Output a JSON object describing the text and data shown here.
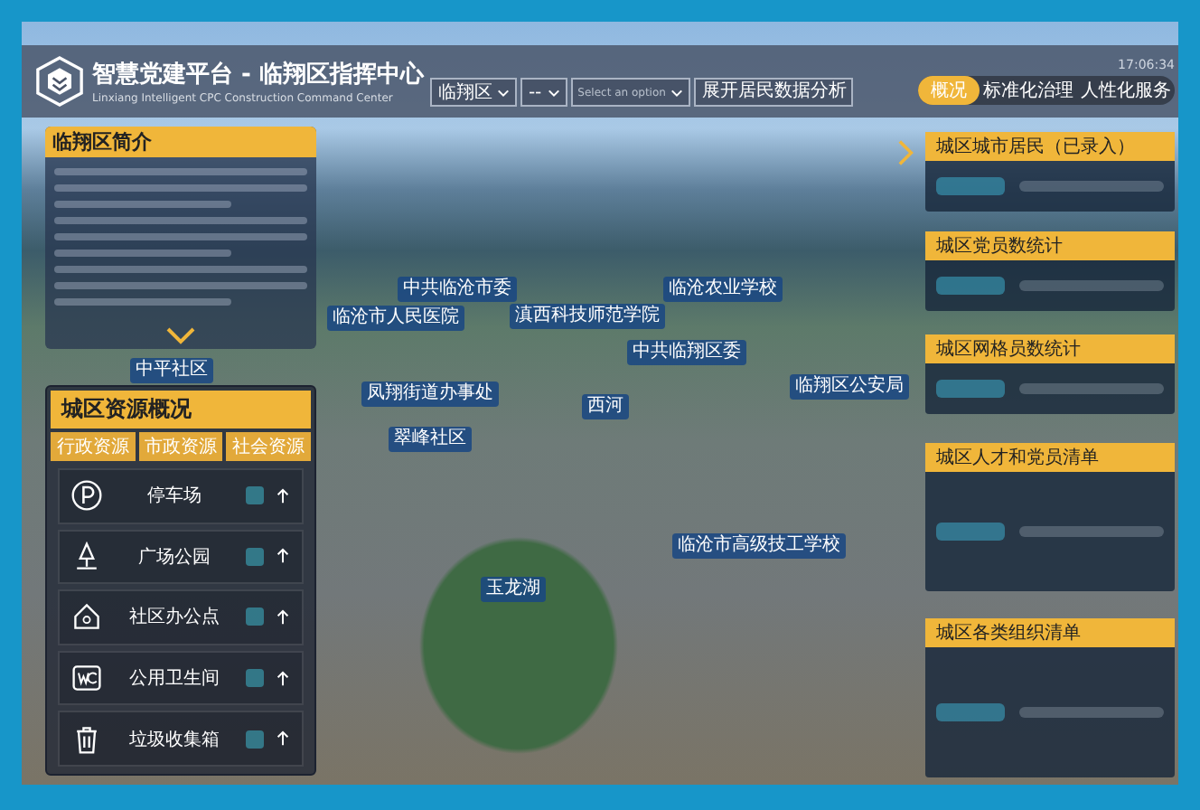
{
  "header": {
    "title": "智慧党建平台 - 临翔区指挥中心",
    "subtitle": "Linxiang Intelligent CPC Construction Command Center",
    "selects": [
      {
        "value": "临翔区"
      },
      {
        "value": "--"
      },
      {
        "placeholder": "Select an option"
      }
    ],
    "button": "展开居民数据分析",
    "time": "17:06:34",
    "tabs": [
      {
        "label": "概况",
        "selected": true
      },
      {
        "label": "标准化治理",
        "selected": false
      },
      {
        "label": "人性化服务",
        "selected": false
      }
    ]
  },
  "intro": {
    "title": "临翔区简介"
  },
  "resources": {
    "title": "城区资源概况",
    "tabs": [
      {
        "label": "行政资源",
        "selected": false
      },
      {
        "label": "市政资源",
        "selected": false
      },
      {
        "label": "社会资源",
        "selected": false
      }
    ],
    "items": [
      {
        "kind": "parking",
        "label": "停车场"
      },
      {
        "kind": "park",
        "label": "广场公园"
      },
      {
        "kind": "office",
        "label": "社区办公点"
      },
      {
        "kind": "toilet",
        "label": "公用卫生间"
      },
      {
        "kind": "trash",
        "label": "垃圾收集箱"
      }
    ]
  },
  "map": {
    "pins": [
      {
        "label": "中共临沧市委"
      },
      {
        "label": "临沧市人民医院"
      },
      {
        "label": "滇西科技师范学院"
      },
      {
        "label": "临沧农业学校"
      },
      {
        "label": "中共临翔区委"
      },
      {
        "label": "凤翔街道办事处"
      },
      {
        "label": "西河"
      },
      {
        "label": "临翔区公安局"
      },
      {
        "label": "翠峰社区"
      },
      {
        "label": "临沧市高级技工学校"
      },
      {
        "label": "玉龙湖"
      },
      {
        "label": "中平社区"
      }
    ]
  },
  "stats": [
    {
      "title": "城区城市居民（已录入）"
    },
    {
      "title": "城区党员数统计"
    },
    {
      "title": "城区网格员数统计"
    },
    {
      "title": "城区人才和党员清单"
    },
    {
      "title": "城区各类组织清单"
    }
  ]
}
